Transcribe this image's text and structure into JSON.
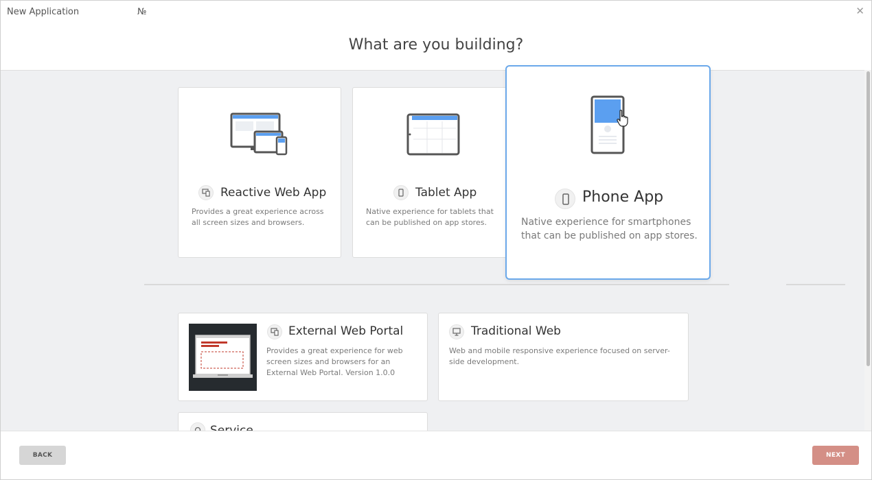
{
  "window": {
    "title": "New Application",
    "title_extra": "№",
    "close_glyph": "✕"
  },
  "heading": "What are you building?",
  "cards": {
    "reactive": {
      "title": "Reactive Web App",
      "desc": "Provides a great experience across all screen sizes and browsers."
    },
    "tablet": {
      "title": "Tablet App",
      "desc": "Native experience for tablets that can be published on app stores."
    },
    "phone": {
      "title": "Phone App",
      "desc": "Native experience for smartphones that can be published on app stores."
    },
    "portal": {
      "title": "External Web Portal",
      "desc": "Provides a great experience for web screen sizes and browsers for an External Web Portal. Version 1.0.0"
    },
    "traditional": {
      "title": "Traditional Web",
      "desc": "Web and mobile responsive experience focused on server-side development."
    },
    "service": {
      "title": "Service"
    }
  },
  "footer": {
    "back": "BACK",
    "next": "NEXT"
  },
  "colors": {
    "accent_blue": "#5b9ff0",
    "selected_border": "#6aa8ea",
    "next_button": "#d48f86"
  }
}
